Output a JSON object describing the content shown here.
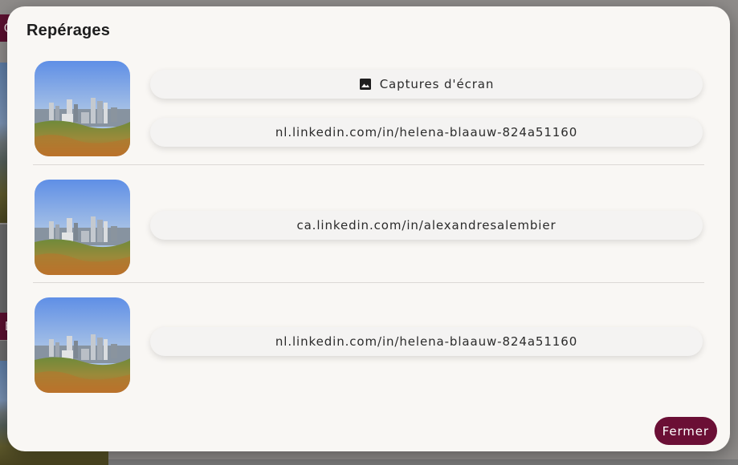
{
  "background": {
    "tag_top": "O",
    "tag_bottom": "E"
  },
  "modal": {
    "title": "Repérages",
    "rows": [
      {
        "screenshot_label": "Captures d'écran",
        "link": "nl.linkedin.com/in/helena-blaauw-824a51160"
      },
      {
        "link": "ca.linkedin.com/in/alexandresalembier"
      },
      {
        "link": "nl.linkedin.com/in/helena-blaauw-824a51160"
      }
    ],
    "close_label": "Fermer"
  },
  "colors": {
    "accent": "#6b0f35",
    "modal_bg": "#f9f7f4",
    "pill_bg": "#f4f3f2"
  },
  "icons": {
    "screenshot": "image-icon",
    "thumbnail": "city-skyline-photo"
  }
}
